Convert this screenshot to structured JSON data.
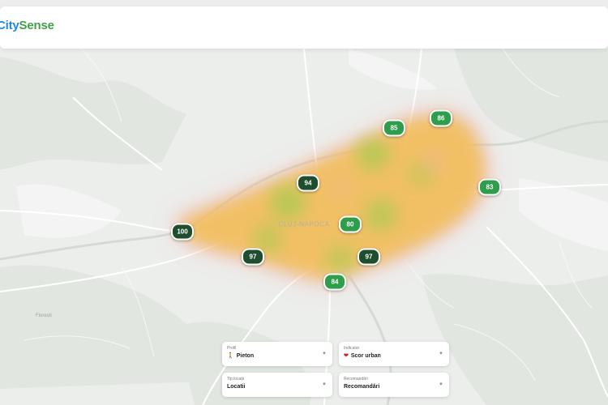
{
  "header": {
    "logo_part1": "CitySense",
    "logo_part2": ""
  },
  "map": {
    "city_label": "CLUJ-NAPOCA",
    "town_label": "Florești",
    "markers": [
      {
        "value": "100",
        "level": "high"
      },
      {
        "value": "94",
        "level": "high"
      },
      {
        "value": "97",
        "level": "high"
      },
      {
        "value": "97",
        "level": "high"
      },
      {
        "value": "80",
        "level": "medium"
      },
      {
        "value": "85",
        "level": "medium"
      },
      {
        "value": "86",
        "level": "medium"
      },
      {
        "value": "83",
        "level": "medium"
      },
      {
        "value": "84",
        "level": "medium"
      }
    ],
    "colors": {
      "high": "#1f4e2e",
      "medium": "#2e9e4d",
      "heat_low": "#f0a0a0",
      "heat_mid": "#f2c060",
      "heat_high": "#8dcf4a"
    }
  },
  "controls": {
    "profile": {
      "label": "Profil",
      "value": "Pieton",
      "icon": "pedestrian-icon"
    },
    "indicator": {
      "label": "Indicator",
      "value": "Scor urban",
      "icon": "heart-icon"
    },
    "location_type": {
      "label": "Tip locații",
      "value": "Locatii"
    },
    "recommendations": {
      "label": "Recomandări",
      "value": "Recomandări"
    }
  }
}
